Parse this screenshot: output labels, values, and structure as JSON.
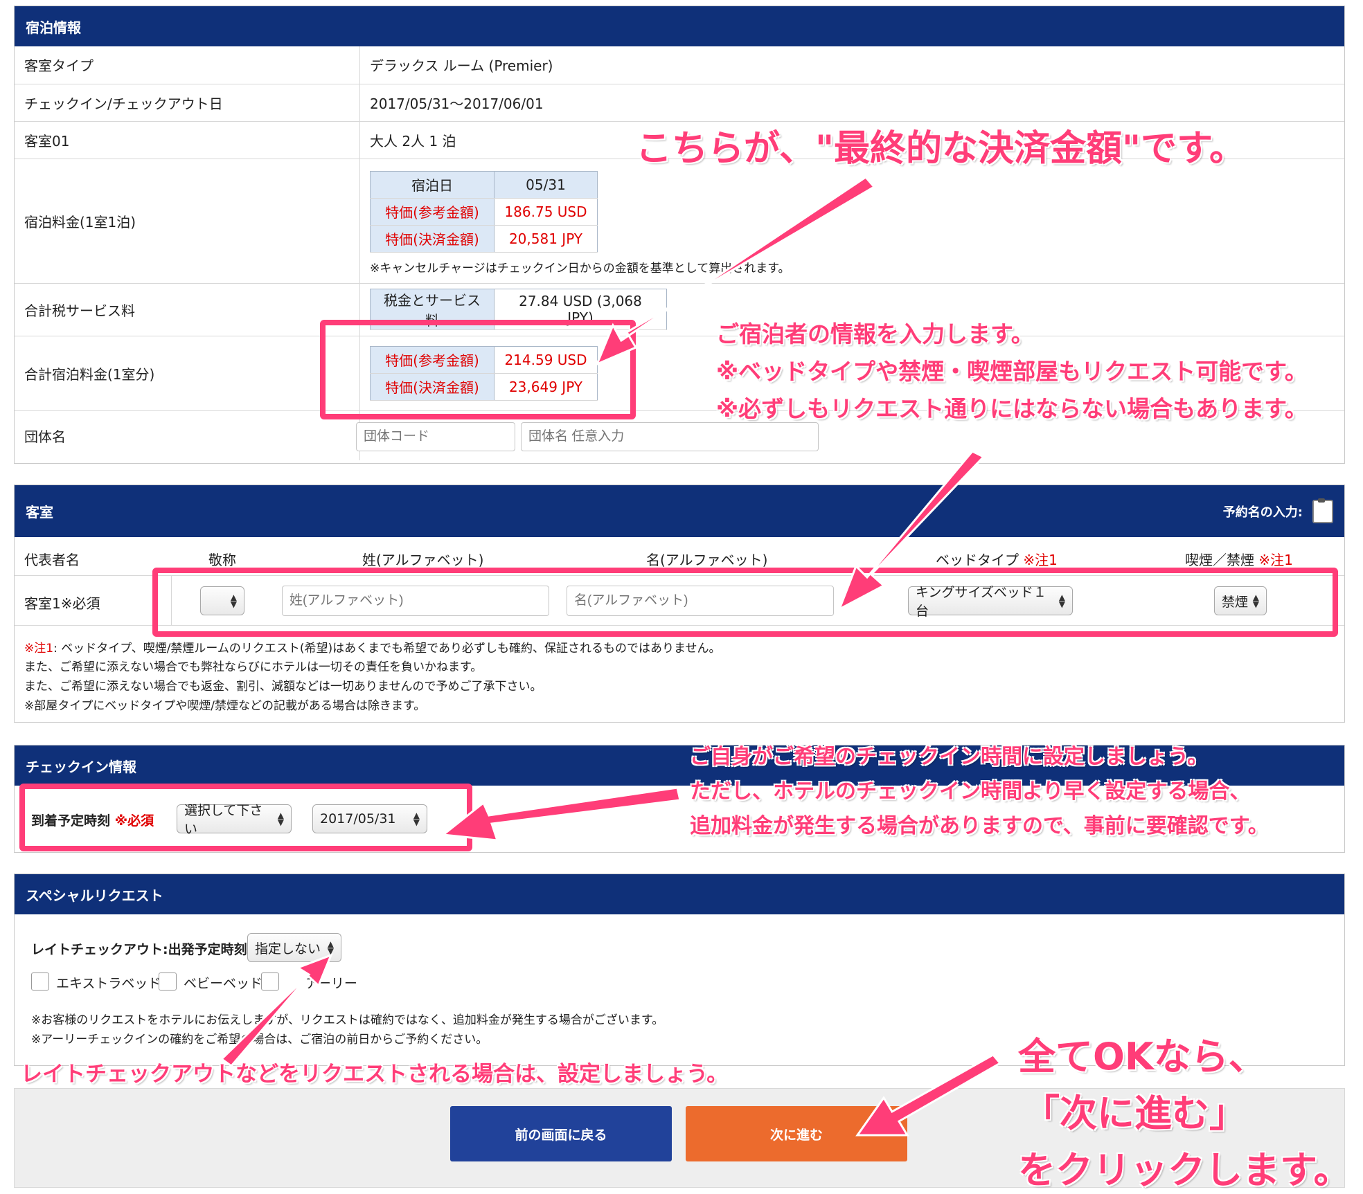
{
  "stay": {
    "header": "宿泊情報",
    "rows": {
      "room_type_label": "客室タイプ",
      "room_type_value": "デラックス ルーム (Premier)",
      "dates_label": "チェックイン/チェックアウト日",
      "dates_value": "2017/05/31～2017/06/01",
      "room01_label": "客室01",
      "room01_value": "大人 2人 1 泊",
      "rate_label": "宿泊料金(1室1泊)",
      "tax_label": "合計税サービス料",
      "total_label": "合計宿泊料金(1室分)",
      "group_label": "団体名"
    },
    "rate_table": {
      "h_date": "宿泊日",
      "date": "05/31",
      "ref_label": "特価(参考金額)",
      "ref_value": "186.75 USD",
      "pay_label": "特価(決済金額)",
      "pay_value": "20,581 JPY"
    },
    "cancel_note": "※キャンセルチャージはチェックイン日からの金額を基準として算出されます。",
    "tax_table": {
      "label": "税金とサービス料",
      "value": "27.84 USD (3,068 JPY)"
    },
    "total_table": {
      "ref_label": "特価(参考金額)",
      "ref_value": "214.59 USD",
      "pay_label": "特価(決済金額)",
      "pay_value": "23,649 JPY"
    },
    "group_code_placeholder": "団体コード",
    "group_name_placeholder": "団体名 任意入力"
  },
  "room": {
    "header": "客室",
    "reservation_name_label": "予約名の入力:",
    "cols": {
      "rep": "代表者名",
      "title": "敬称",
      "last": "姓(アルファベット)",
      "first": "名(アルファベット)",
      "bed": "ベッドタイプ",
      "smoke": "喫煙／禁煙",
      "note_mark": "※注1"
    },
    "row_label": "客室1※必須",
    "last_placeholder": "姓(アルファベット)",
    "first_placeholder": "名(アルファベット)",
    "bed_value": "キングサイズベッド１台",
    "smoke_value": "禁煙",
    "notes": [
      "ベッドタイプ、喫煙/禁煙ルームのリクエスト(希望)はあくまでも希望であり必ずしも確約、保証されるものではありません。",
      "また、ご希望に添えない場合でも弊社ならびにホテルは一切その責任を負いかねます。",
      "また、ご希望に添えない場合でも返金、割引、減額などは一切ありませんので予めご了承下さい。",
      "※部屋タイプにベッドタイプや喫煙/禁煙などの記載がある場合は除きます。"
    ],
    "note_prefix": "※注1"
  },
  "checkin": {
    "header": "チェックイン情報",
    "arrival_label": "到着予定時刻",
    "required": "※必須",
    "time_value": "選択して下さい",
    "date_value": "2017/05/31"
  },
  "special": {
    "header": "スペシャルリクエスト",
    "late_label": "レイトチェックアウト:出発予定時刻",
    "late_value": "指定しない",
    "extra_bed": "エキストラベッド",
    "baby_bed": "ベビーベッド",
    "third": "アーリー",
    "note1": "※お客様のリクエストをホテルにお伝えしますが、リクエストは確約ではなく、追加料金が発生する場合がございます。",
    "note2": "※アーリーチェックインの確約をご希望の場合は、ご宿泊の前日からご予約ください。"
  },
  "buttons": {
    "back": "前の画面に戻る",
    "next": "次に進む"
  },
  "annotations": {
    "a1": "こちらが、\"最終的な決済金額\"です。",
    "a2_1": "ご宿泊者の情報を入力します。",
    "a2_2": "※ベッドタイプや禁煙・喫煙部屋もリクエスト可能です。",
    "a2_3": "※必ずしもリクエスト通りにはならない場合もあります。",
    "a3_1": "ご自身がご希望のチェックイン時間に設定しましょう。",
    "a3_2": "ただし、ホテルのチェックイン時間より早く設定する場合、",
    "a3_3": "追加料金が発生する場合がありますので、事前に要確認です。",
    "a4": "レイトチェックアウトなどをリクエストされる場合は、設定しましょう。",
    "a5_1": "全てOKなら、",
    "a5_2": "「次に進む」",
    "a5_3": "をクリックします。"
  },
  "colors": {
    "header": "#0f3079",
    "accent_pink": "#ff3d78",
    "back_btn": "#21429a",
    "next_btn": "#ec6b2d",
    "red": "#e00000"
  }
}
